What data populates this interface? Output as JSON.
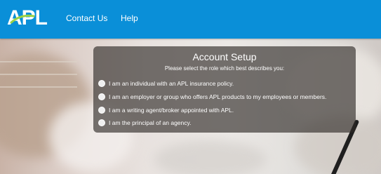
{
  "header": {
    "logo_text": "APL",
    "nav": [
      {
        "label": "Contact Us"
      },
      {
        "label": "Help"
      }
    ],
    "background_color": "#0a8fd8"
  },
  "setup": {
    "title": "Account Setup",
    "subtitle": "Please select the role which best describes you:",
    "options": [
      {
        "label": "I am an individual with an APL insurance policy."
      },
      {
        "label": "I am an employer or group who offers APL products to my employees or members."
      },
      {
        "label": "I am a writing agent/broker appointed with APL."
      },
      {
        "label": "I am the principal of an agency."
      }
    ]
  },
  "colors": {
    "logo_green": "#9bd244",
    "panel_bg": "rgba(45,40,38,0.64)"
  }
}
